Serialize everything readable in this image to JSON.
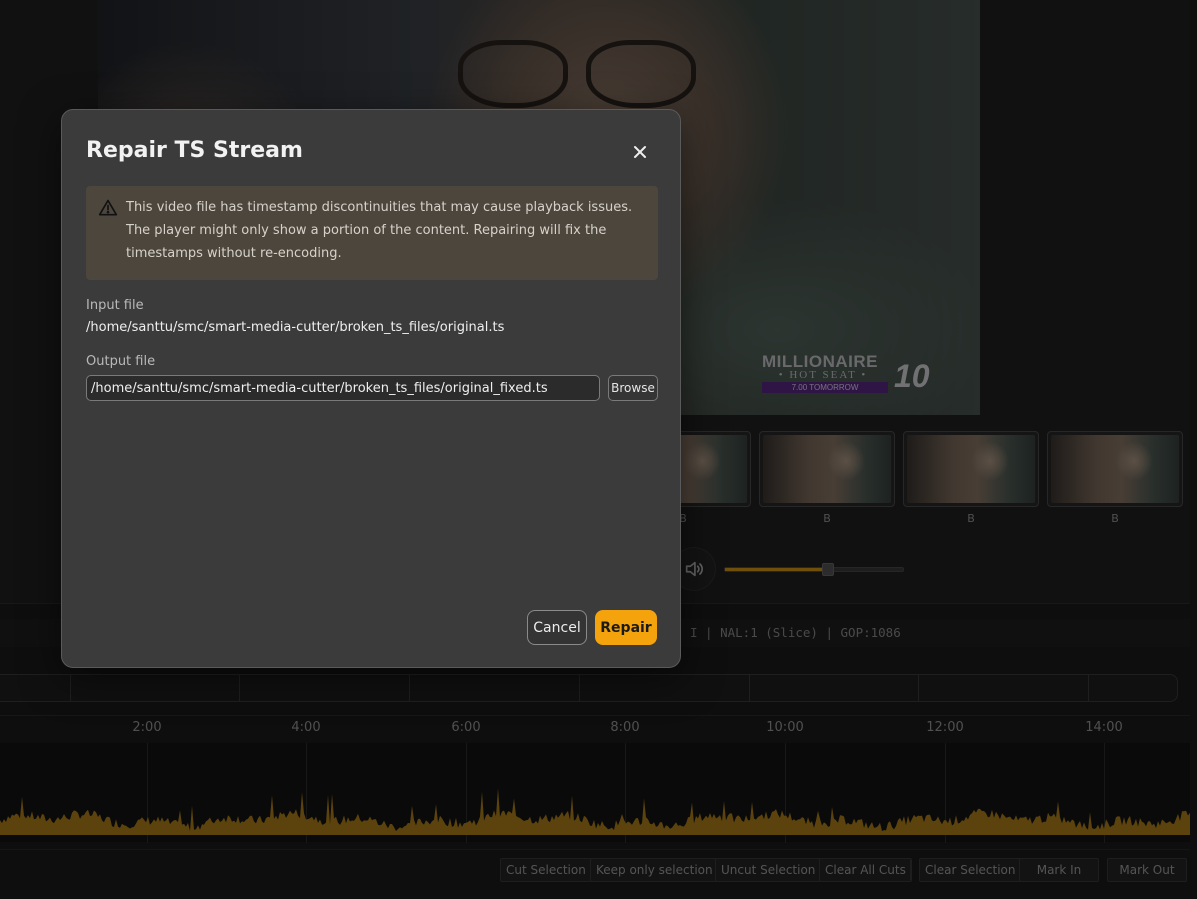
{
  "video": {
    "overlay_title_line1": "MILLIONAIRE",
    "overlay_title_line2": "• HOT SEAT •",
    "overlay_title_line3": "7.00 TOMORROW",
    "channel_logo": "10"
  },
  "thumbnails": [
    {
      "label": "B"
    },
    {
      "label": "B"
    },
    {
      "label": "B"
    },
    {
      "label": "B"
    }
  ],
  "volume": {
    "level": 0.58,
    "accent_color": "#d49a16"
  },
  "info_bar": {
    "text": "I | NAL:1 (Slice) | GOP:1086"
  },
  "timeline": {
    "labels": [
      "2:00",
      "4:00",
      "6:00",
      "8:00",
      "10:00",
      "12:00",
      "14:00"
    ],
    "waveform_color": "#b0811a"
  },
  "toolbar": {
    "cut_selection": "Cut Selection",
    "keep_only_selection": "Keep only selection",
    "uncut_selection": "Uncut Selection",
    "clear_all_cuts": "Clear All Cuts",
    "clear_selection": "Clear Selection",
    "mark_in": "Mark In",
    "mark_out": "Mark Out"
  },
  "dialog": {
    "title": "Repair TS Stream",
    "close_icon": "close-icon",
    "warning_icon": "warning-triangle-icon",
    "warning_text": "This video file has timestamp discontinuities that may cause playback issues. The player might only show a portion of the content. Repairing will fix the timestamps without re-encoding.",
    "input_label": "Input file",
    "input_value": "/home/santtu/smc/smart-media-cutter/broken_ts_files/original.ts",
    "output_label": "Output file",
    "output_value": "/home/santtu/smc/smart-media-cutter/broken_ts_files/original_fixed.ts",
    "browse_label": "Browse",
    "cancel_label": "Cancel",
    "repair_label": "Repair",
    "accent_color": "#f5a30c"
  }
}
